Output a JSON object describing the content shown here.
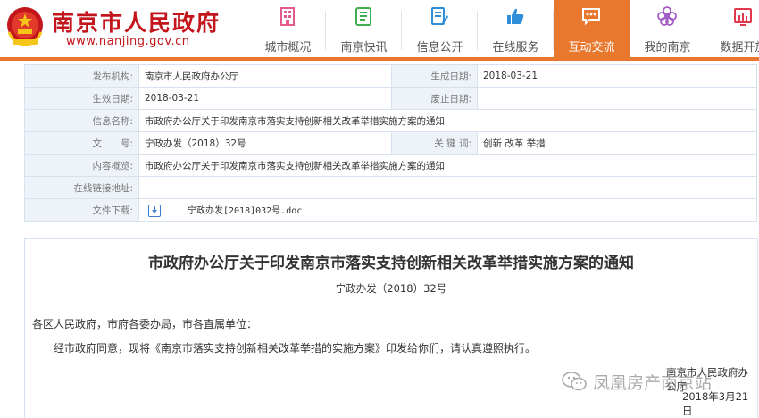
{
  "header": {
    "site_title": "南京市人民政府",
    "site_url": "www.nanjing.gov.cn",
    "accent_color": "#e8782e",
    "brand_color": "#c3161c"
  },
  "nav": [
    {
      "label": "城市概况",
      "icon": "city-building-icon"
    },
    {
      "label": "南京快讯",
      "icon": "news-notebook-icon"
    },
    {
      "label": "信息公开",
      "icon": "document-edit-icon"
    },
    {
      "label": "在线服务",
      "icon": "thumbs-up-icon"
    },
    {
      "label": "互动交流",
      "icon": "chat-bubble-icon",
      "active": true
    },
    {
      "label": "我的南京",
      "icon": "flower-icon"
    },
    {
      "label": "数据开放",
      "icon": "bar-chart-icon"
    }
  ],
  "meta": {
    "issuer_label": "发布机构:",
    "issuer": "南京市人民政府办公厅",
    "created_label": "生成日期:",
    "created": "2018-03-21",
    "effective_label": "生效日期:",
    "effective": "2018-03-21",
    "repeal_label": "废止日期:",
    "repeal": "",
    "name_label": "信息名称:",
    "name": "市政府办公厅关于印发南京市落实支持创新相关改革举措实施方案的通知",
    "docno_label": "文　　号:",
    "docno": "宁政办发（2018）32号",
    "keywords_label": "关 键 词:",
    "keywords": "创新  改革  举措",
    "summary_label": "内容概览:",
    "summary": "市政府办公厅关于印发南京市落实支持创新相关改革举措实施方案的通知",
    "link_label": "在线链接地址:",
    "link": "",
    "download_label": "文件下载:",
    "download_file": "宁政办发[2018]032号.doc"
  },
  "article": {
    "title": "市政府办公厅关于印发南京市落实支持创新相关改革举措实施方案的通知",
    "doc_number": "宁政办发（2018）32号",
    "addressee": "各区人民政府，市府各委办局，市各直属单位：",
    "body": "经市政府同意，现将《南京市落实支持创新相关改革举措的实施方案》印发给你们，请认真遵照执行。",
    "issuer": "南京市人民政府办公厅",
    "date": "2018年3月21日"
  },
  "watermark": {
    "text": "凤凰房产南京站",
    "icon": "wechat-icon"
  }
}
